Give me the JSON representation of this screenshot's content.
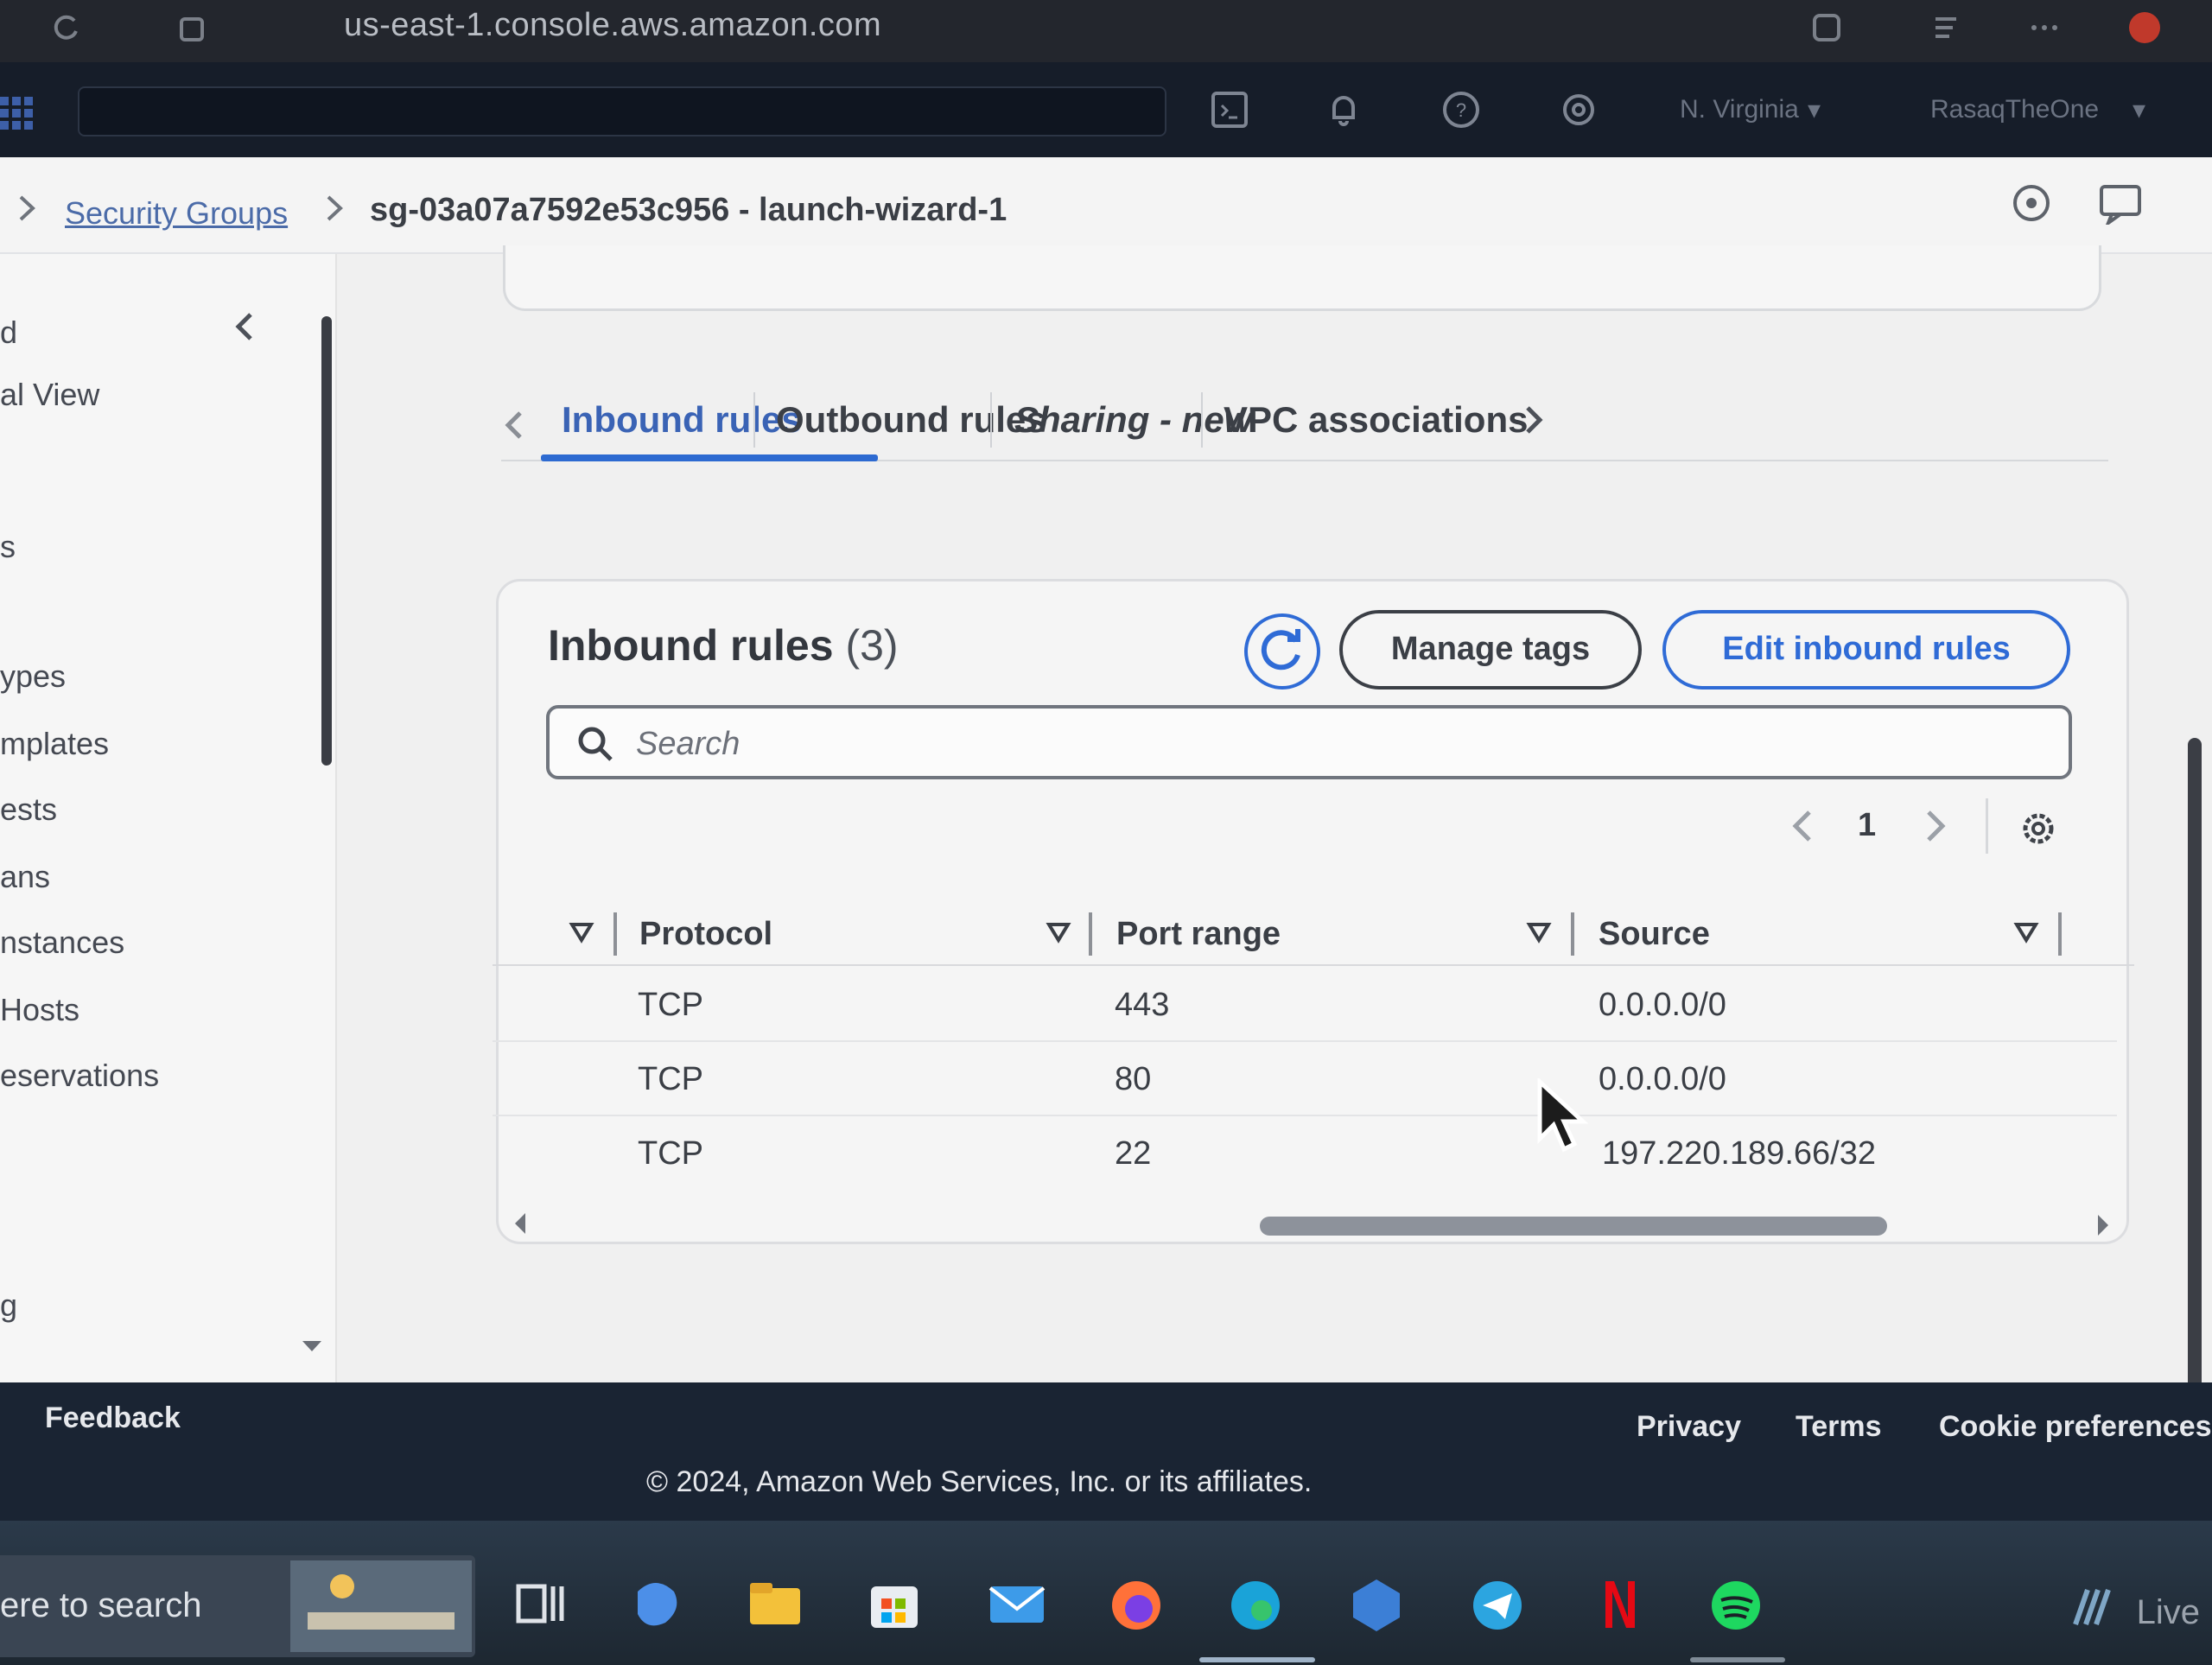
{
  "browser": {
    "url": "us-east-1.console.aws.amazon.com"
  },
  "header": {
    "region": "N. Virginia",
    "account": "RasaqTheOne"
  },
  "breadcrumb": {
    "parent": "Security Groups",
    "current": "sg-03a07a7592e53c956 - launch-wizard-1"
  },
  "sidebar": {
    "items": [
      "al View",
      "s",
      "ypes",
      "mplates",
      "ests",
      "ans",
      "nstances",
      "Hosts",
      "eservations",
      "g"
    ]
  },
  "tabs": [
    {
      "label": "Inbound rules",
      "active": true
    },
    {
      "label": "Outbound rules",
      "active": false
    },
    {
      "label": "Sharing - new",
      "active": false
    },
    {
      "label": "VPC associations",
      "active": false
    }
  ],
  "panel": {
    "title": "Inbound rules",
    "count": "(3)",
    "manage_tags": "Manage tags",
    "edit_rules": "Edit inbound rules",
    "search_placeholder": "Search",
    "page": "1"
  },
  "table": {
    "columns": [
      "Protocol",
      "Port range",
      "Source"
    ],
    "rows": [
      {
        "protocol": "TCP",
        "port": "443",
        "source": "0.0.0.0/0"
      },
      {
        "protocol": "TCP",
        "port": "80",
        "source": "0.0.0.0/0"
      },
      {
        "protocol": "TCP",
        "port": "22",
        "source": "197.220.189.66/32"
      }
    ]
  },
  "footer": {
    "feedback": "Feedback",
    "privacy": "Privacy",
    "terms": "Terms",
    "cookies": "Cookie preferences",
    "copyright": "© 2024, Amazon Web Services, Inc. or its affiliates."
  },
  "taskbar": {
    "search_text": "ere to search",
    "live": "Live"
  },
  "colors": {
    "accent": "#2f6bd6",
    "header": "#161d29",
    "footer": "#1a2433"
  }
}
